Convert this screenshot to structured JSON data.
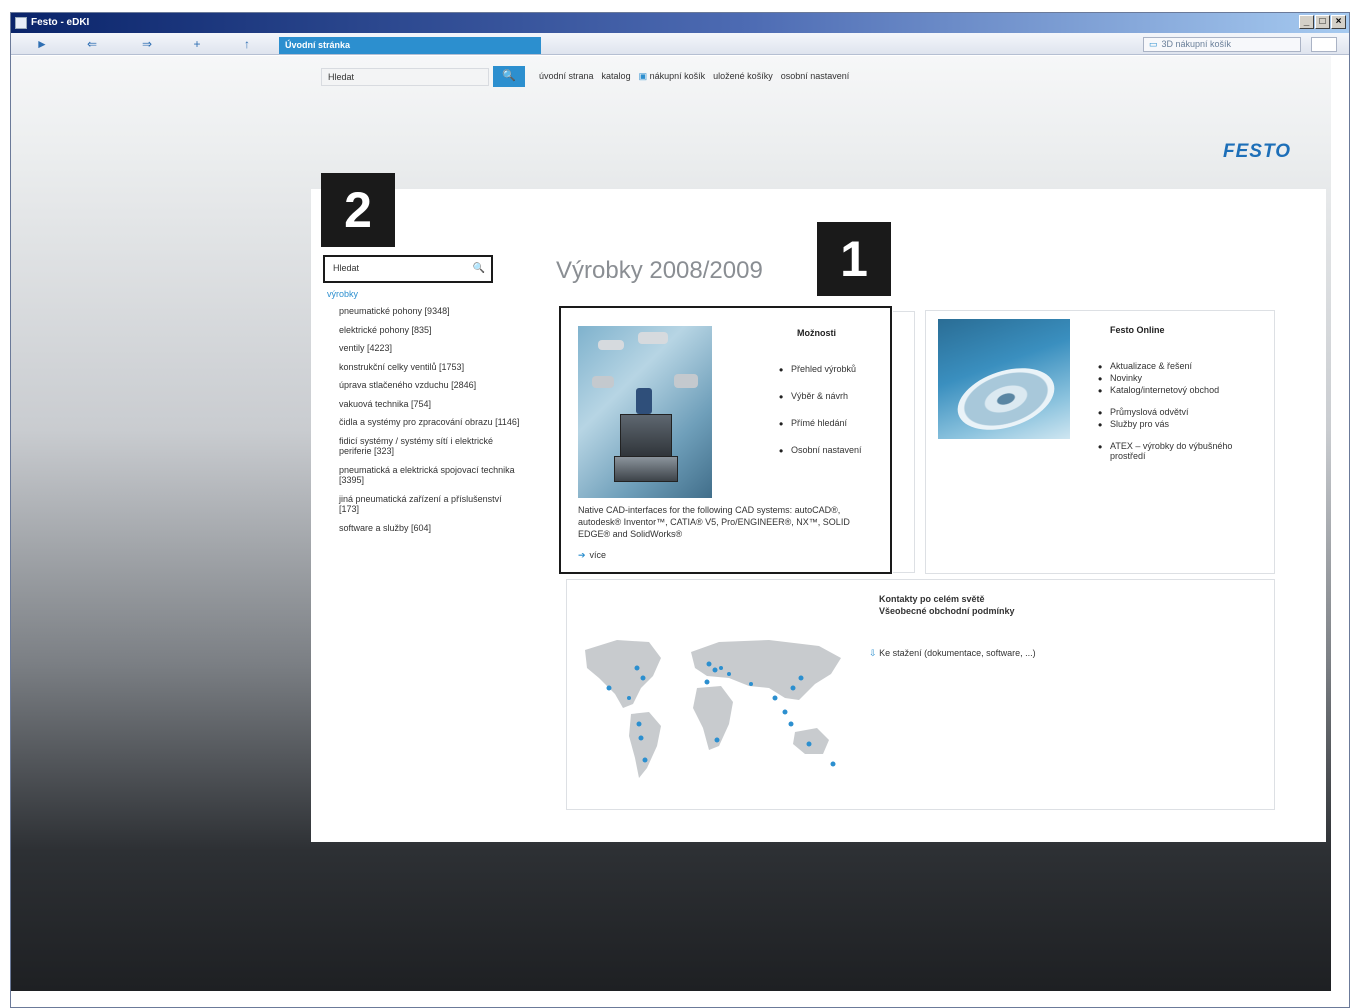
{
  "window": {
    "title": "Festo - eDKI",
    "controls": [
      "_",
      "□",
      "×"
    ]
  },
  "toolbar": {
    "buttons": [
      "►",
      "⇐",
      "⇒",
      "+",
      "↑"
    ],
    "tab_label": "Úvodní stránka",
    "cart_button": "3D nákupní košík"
  },
  "top": {
    "search_value": "Hledat",
    "search_button": "🔍",
    "nav": [
      "úvodní strana",
      "katalog",
      "nákupní košík",
      "uložené košíky",
      "osobní nastavení"
    ],
    "logo": "FESTO"
  },
  "callouts": {
    "one": "1",
    "two": "2"
  },
  "sidebar": {
    "search_value": "Hledat",
    "category_head": "výrobky",
    "categories": [
      "pneumatické pohony [9348]",
      "elektrické pohony [835]",
      "ventily [4223]",
      "konstrukční celky ventilů [1753]",
      "úprava stlačeného vzduchu [2846]",
      "vakuová technika [754]",
      "čidla a systémy pro zpracování obrazu [1146]",
      "fidicí systémy / systémy sítí i elektrické periferie [323]",
      "pneumatická a elektrická spojovací technika [3395]",
      "jiná pneumatická zařízení a příslušenství [173]",
      "software a služby [604]"
    ]
  },
  "main": {
    "heading": "Výrobky 2008/2009",
    "card1": {
      "title": "Možnosti",
      "items": [
        "Přehled výrobků",
        "Výběr & návrh",
        "Přímé hledání",
        "Osobní nastavení"
      ],
      "cad_text": "Native CAD-interfaces for the following CAD systems: autoCAD®, autodesk® Inventor™, CATIA® V5, Pro/ENGINEER®, NX™, SOLID EDGE® and SolidWorks®",
      "more": "více"
    },
    "card2": {
      "title": "Festo Online",
      "items": [
        "Aktualizace & řešení",
        "Novinky",
        "Katalog/internetový obchod",
        "Průmyslová odvětví",
        "Služby pro vás",
        "ATEX – výrobky do výbušného prostředí"
      ]
    },
    "card3": {
      "line1": "Kontakty po celém světě",
      "line2": "Všeobecné obchodní podmínky",
      "download": "Ke stažení (dokumentace, software, ...)"
    }
  },
  "colors": {
    "accent": "#2c8fcf",
    "logo": "#1d6fb8",
    "heading": "#8a8e93"
  }
}
